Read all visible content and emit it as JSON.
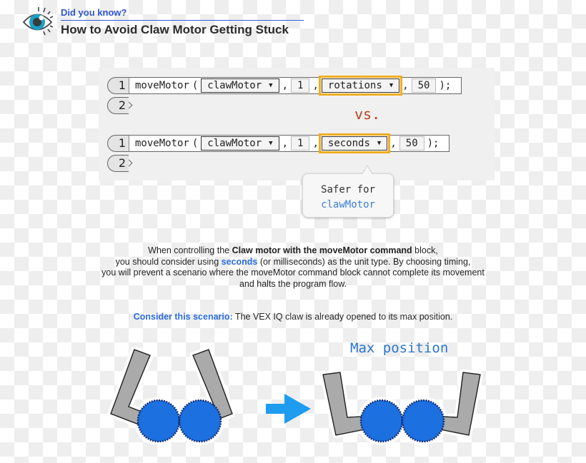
{
  "header": {
    "icon": "eye-icon",
    "kicker": "Did you know?",
    "title": "How to Avoid Claw Motor Getting Stuck"
  },
  "code_examples": [
    {
      "line_numbers": [
        "1",
        "2"
      ],
      "function": "moveMotor",
      "open_paren": "(",
      "motor": "clawMotor",
      "amount": "1",
      "unit": "rotations",
      "speed": "50",
      "close": ");",
      "unit_highlighted": true
    },
    {
      "line_numbers": [
        "1",
        "2"
      ],
      "function": "moveMotor",
      "open_paren": "(",
      "motor": "clawMotor",
      "amount": "1",
      "unit": "seconds",
      "speed": "50",
      "close": ");",
      "unit_highlighted": true
    }
  ],
  "vs_label": "vs.",
  "tooltip": {
    "line1": "Safer for",
    "line2": "clawMotor"
  },
  "explanation": {
    "p1_pre": "When controlling the ",
    "p1_bold": "Claw motor with the moveMotor command",
    "p1_post": " block,",
    "p2_pre": "you should consider using ",
    "p2_highlight": "seconds",
    "p2_post": " (or milliseconds) as the unit type. By choosing timing,",
    "p3": "you will prevent a scenario where the moveMotor command block cannot complete its movement",
    "p4": "and halts the program flow."
  },
  "scenario": {
    "label": "Consider this scenario:",
    "text": " The VEX IQ claw is already opened to its max position."
  },
  "diagram": {
    "max_label": "Max position",
    "colors": {
      "gear": "#1f6fe0",
      "arm": "#aaaaaa",
      "arrow": "#1e9cf0"
    }
  }
}
